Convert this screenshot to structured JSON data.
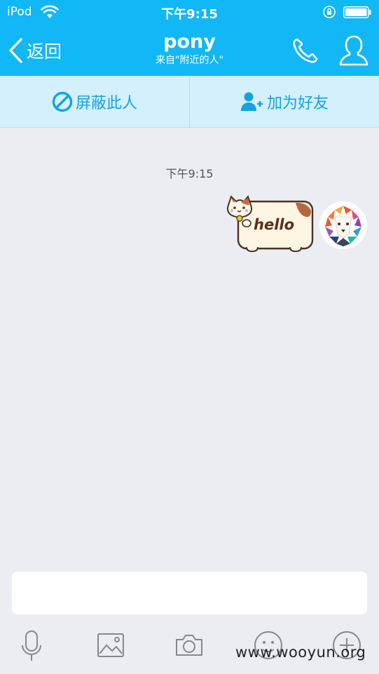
{
  "status_bar": {
    "carrier": "iPod",
    "time": "下午9:15"
  },
  "nav": {
    "back_label": "返回",
    "title": "pony",
    "subtitle": "来自\"附近的人\""
  },
  "actions": {
    "block_label": "屏蔽此人",
    "add_friend_label": "加为好友"
  },
  "chat": {
    "timestamp": "下午9:15",
    "sticker_text": "hello"
  },
  "input": {
    "value": ""
  },
  "watermark": "www.wooyun.org",
  "colors": {
    "accent": "#12b7f5",
    "action_bar": "#d4f0fc",
    "action_text": "#12a4e0",
    "background": "#ebedf2"
  },
  "icons": {
    "toolbar": [
      "microphone-icon",
      "image-icon",
      "camera-icon",
      "emoji-icon",
      "plus-icon"
    ]
  }
}
